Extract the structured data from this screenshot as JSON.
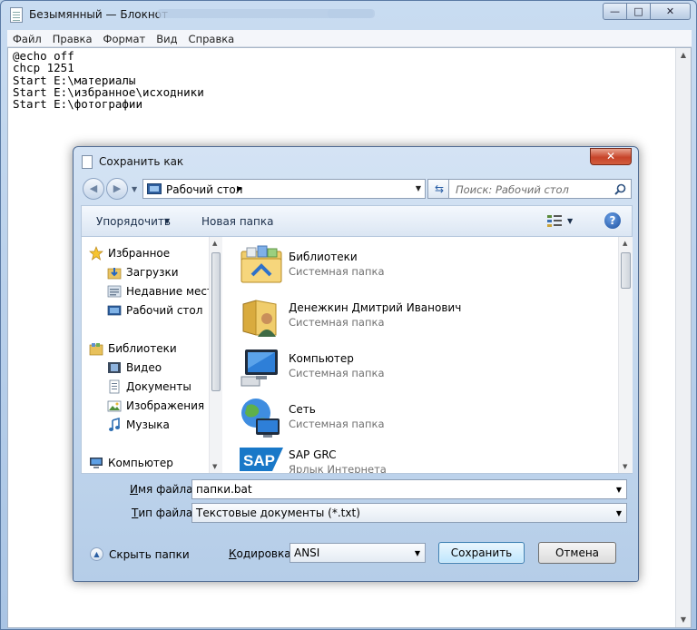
{
  "notepad": {
    "title": "Безымянный — Блокнот",
    "caption_buttons": {
      "minimize": "—",
      "maximize": "□",
      "close": "✕"
    },
    "menu": [
      "Файл",
      "Правка",
      "Формат",
      "Вид",
      "Справка"
    ],
    "lines": [
      "@echo off",
      "chcp 1251",
      "Start E:\\материалы",
      "Start E:\\избранное\\исходники",
      "Start E:\\фотографии"
    ]
  },
  "dialog": {
    "title": "Сохранить как",
    "close": "✕",
    "address": "Рабочий стол",
    "search_placeholder": "Поиск: Рабочий стол",
    "toolbar": {
      "organize": "Упорядочить",
      "new_folder": "Новая папка",
      "help": "?"
    },
    "nav": {
      "favorites": "Избранное",
      "downloads": "Загрузки",
      "recent": "Недавние места",
      "desktop": "Рабочий стол",
      "libraries": "Библиотеки",
      "video": "Видео",
      "documents": "Документы",
      "images": "Изображения",
      "music": "Музыка",
      "computer": "Компьютер"
    },
    "files": [
      {
        "name": "Библиотеки",
        "type": "Системная папка",
        "icon": "libraries-icon"
      },
      {
        "name": "Денежкин Дмитрий Иванович",
        "type": "Системная папка",
        "icon": "user-folder-icon"
      },
      {
        "name": "Компьютер",
        "type": "Системная папка",
        "icon": "computer-icon"
      },
      {
        "name": "Сеть",
        "type": "Системная папка",
        "icon": "network-icon"
      },
      {
        "name": "SAP GRC",
        "type": "Ярлык Интернета",
        "icon": "sap-icon"
      }
    ],
    "filename_label": "Имя файла:",
    "filename_label_key": "И",
    "filename_label_rest": "мя файла:",
    "filename_value": "папки.bat",
    "filetype_label_key": "Т",
    "filetype_label_rest": "ип файла:",
    "filetype_value": "Текстовые документы (*.txt)",
    "hide_folders": "Скрыть папки",
    "encoding_label_key": "К",
    "encoding_label_rest": "одировка:",
    "encoding_value": "ANSI",
    "save": "Сохранить",
    "cancel": "Отмена"
  },
  "colors": {
    "accent": "#3c7fb1",
    "title_bg": "#c9dcf1",
    "close_red": "#c7442a",
    "secondary_text": "#717171"
  }
}
